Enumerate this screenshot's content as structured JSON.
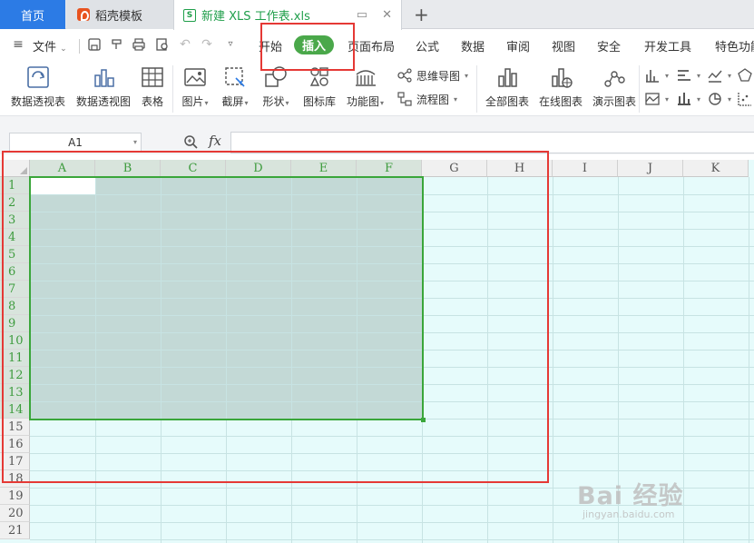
{
  "tabs": {
    "home": "首页",
    "template": "稻壳模板",
    "document": "新建 XLS 工作表.xls",
    "add": "+"
  },
  "menu": {
    "file": "文件",
    "items": [
      "开始",
      "插入",
      "页面布局",
      "公式",
      "数据",
      "审阅",
      "视图",
      "安全",
      "开发工具",
      "特色功能"
    ],
    "active": "插入"
  },
  "ribbon": {
    "pivot_table": "数据透视表",
    "pivot_chart": "数据透视图",
    "table": "表格",
    "picture": "图片",
    "screenshot": "截屏",
    "shape": "形状",
    "icon_lib": "图标库",
    "func_chart": "功能图",
    "mindmap": "思维导图",
    "flowchart": "流程图",
    "all_charts": "全部图表",
    "online_chart": "在线图表",
    "demo_chart": "演示图表"
  },
  "formula": {
    "cell_ref": "A1",
    "fx": "fx",
    "value": ""
  },
  "grid": {
    "columns": [
      "A",
      "B",
      "C",
      "D",
      "E",
      "F",
      "G",
      "H",
      "I",
      "J",
      "K"
    ],
    "rows": [
      "1",
      "2",
      "3",
      "4",
      "5",
      "6",
      "7",
      "8",
      "9",
      "10",
      "11",
      "12",
      "13",
      "14",
      "15",
      "16",
      "17",
      "18",
      "19",
      "20",
      "21"
    ],
    "selection": "A1:F14"
  },
  "watermark": {
    "main": "Bai 经验",
    "sub": "jingyan.baidu.com"
  },
  "colors": {
    "accent_green": "#3aa63a",
    "insert_pill": "#4aa84a",
    "annotation_red": "#e53935",
    "home_tab": "#2c7be5"
  }
}
